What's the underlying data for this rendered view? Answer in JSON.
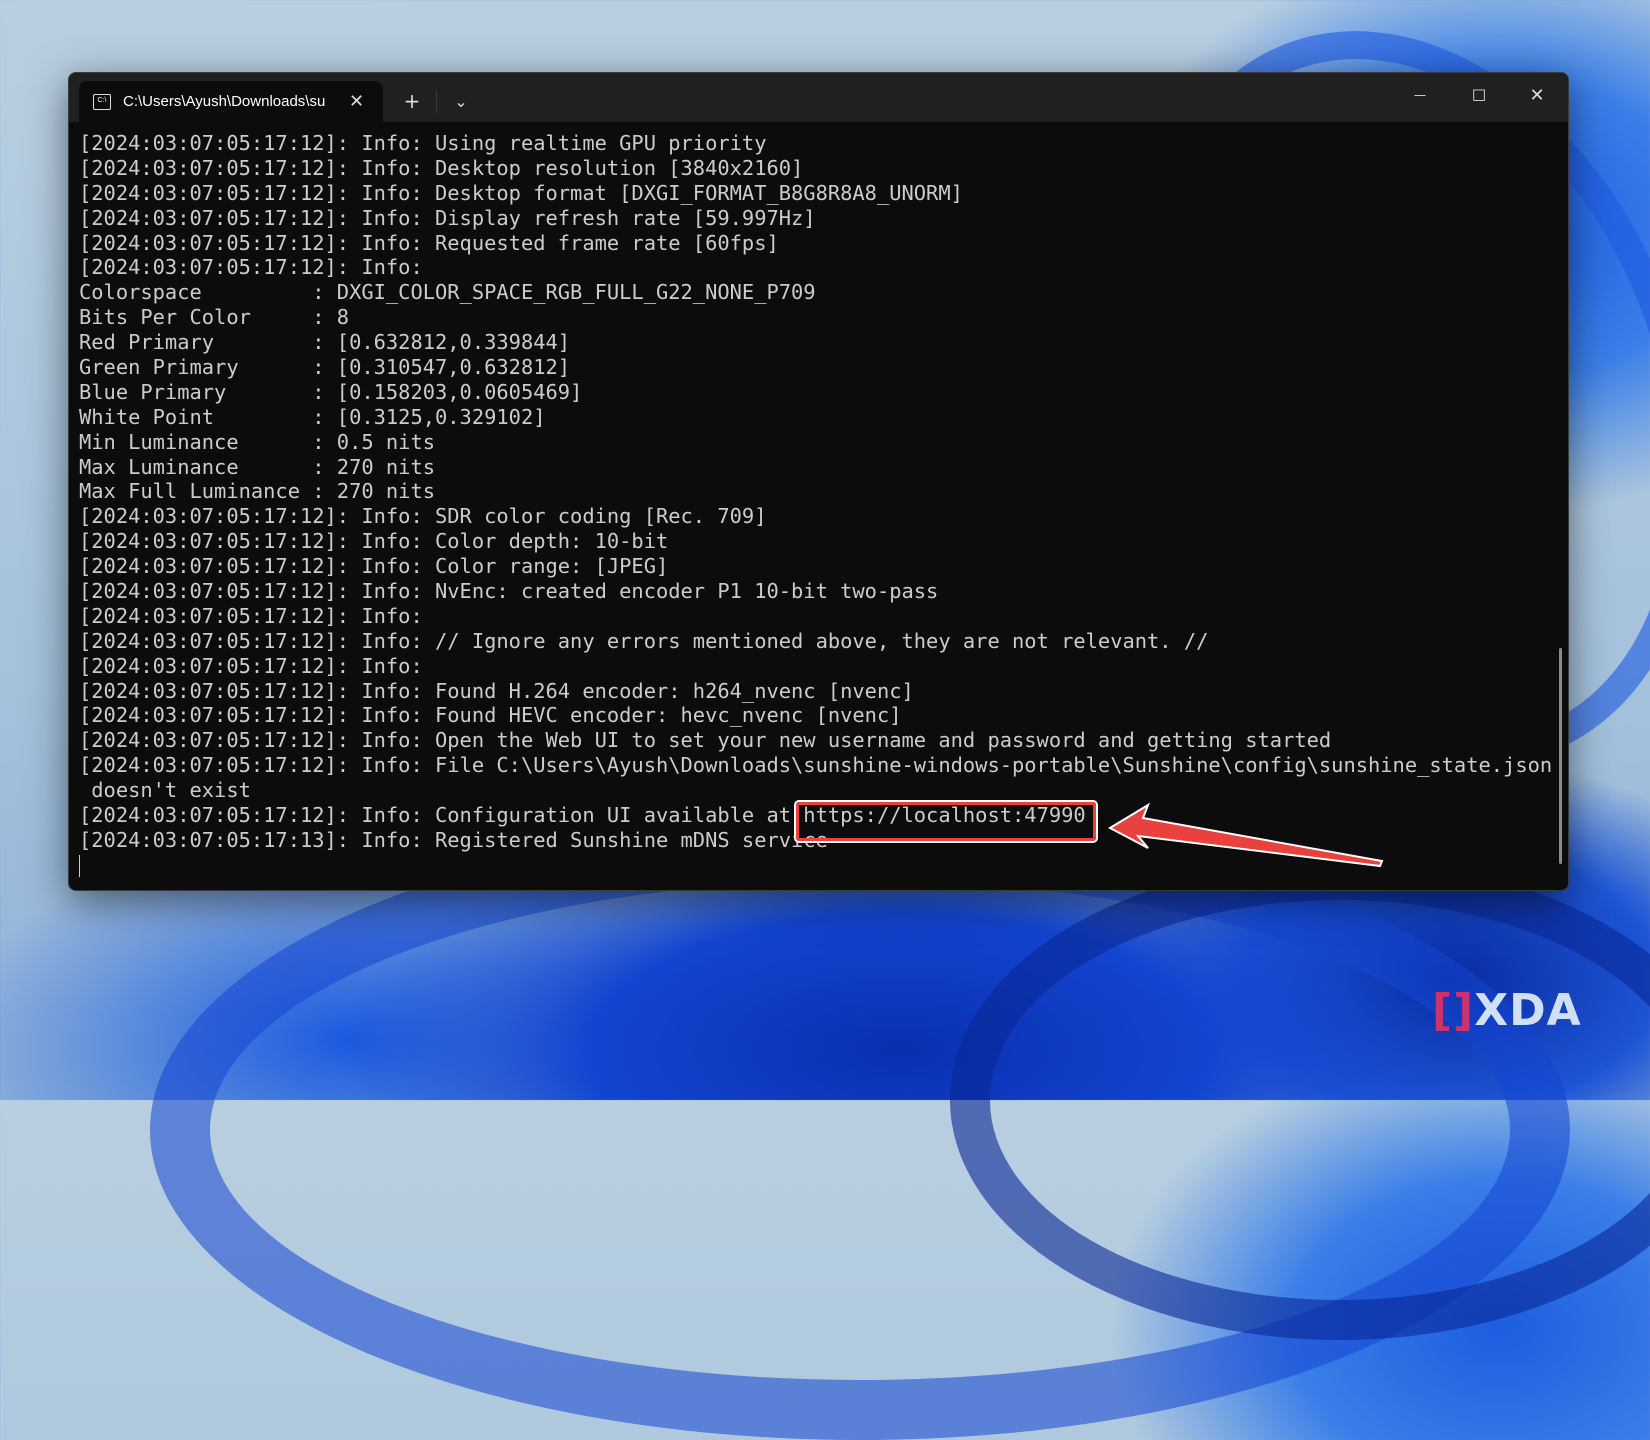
{
  "window": {
    "tab_title": "C:\\Users\\Ayush\\Downloads\\su",
    "new_tab_label": "+",
    "dropdown_label": "⌄",
    "minimize_label": "—",
    "maximize_label": "☐",
    "close_label": "✕",
    "tab_close_label": "✕",
    "tab_icon_text": "C:\\"
  },
  "console": {
    "lines": [
      "[2024:03:07:05:17:12]: Info: Using realtime GPU priority",
      "[2024:03:07:05:17:12]: Info: Desktop resolution [3840x2160]",
      "[2024:03:07:05:17:12]: Info: Desktop format [DXGI_FORMAT_B8G8R8A8_UNORM]",
      "[2024:03:07:05:17:12]: Info: Display refresh rate [59.997Hz]",
      "[2024:03:07:05:17:12]: Info: Requested frame rate [60fps]",
      "[2024:03:07:05:17:12]: Info:",
      "Colorspace         : DXGI_COLOR_SPACE_RGB_FULL_G22_NONE_P709",
      "Bits Per Color     : 8",
      "Red Primary        : [0.632812,0.339844]",
      "Green Primary      : [0.310547,0.632812]",
      "Blue Primary       : [0.158203,0.0605469]",
      "White Point        : [0.3125,0.329102]",
      "Min Luminance      : 0.5 nits",
      "Max Luminance      : 270 nits",
      "Max Full Luminance : 270 nits",
      "[2024:03:07:05:17:12]: Info: SDR color coding [Rec. 709]",
      "[2024:03:07:05:17:12]: Info: Color depth: 10-bit",
      "[2024:03:07:05:17:12]: Info: Color range: [JPEG]",
      "[2024:03:07:05:17:12]: Info: NvEnc: created encoder P1 10-bit two-pass",
      "[2024:03:07:05:17:12]: Info:",
      "[2024:03:07:05:17:12]: Info: // Ignore any errors mentioned above, they are not relevant. //",
      "[2024:03:07:05:17:12]: Info:",
      "[2024:03:07:05:17:12]: Info: Found H.264 encoder: h264_nvenc [nvenc]",
      "[2024:03:07:05:17:12]: Info: Found HEVC encoder: hevc_nvenc [nvenc]",
      "[2024:03:07:05:17:12]: Info: Open the Web UI to set your new username and password and getting started",
      "[2024:03:07:05:17:12]: Info: File C:\\Users\\Ayush\\Downloads\\sunshine-windows-portable\\Sunshine\\config\\sunshine_state.json",
      " doesn't exist",
      "[2024:03:07:05:17:12]: Info: Configuration UI available at https://localhost:47990",
      "[2024:03:07:05:17:13]: Info: Registered Sunshine mDNS service"
    ]
  },
  "highlight": {
    "url": "https://localhost:47990",
    "color": "#e8413e"
  },
  "watermark": "XDA"
}
